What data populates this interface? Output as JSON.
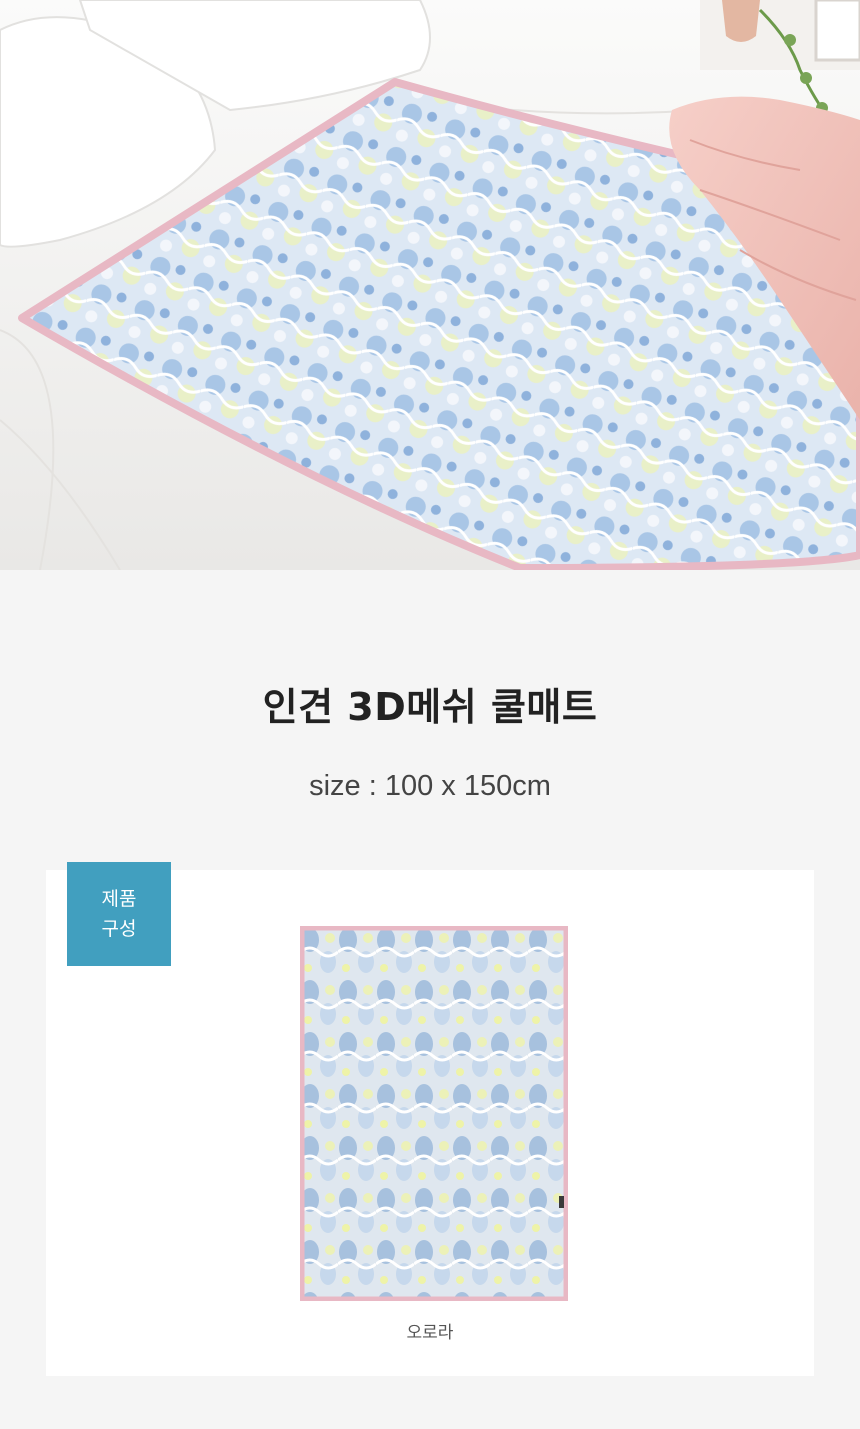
{
  "header": {
    "title": "인견 3D메쉬 쿨매트",
    "size_text": "size : 100 x 150cm"
  },
  "hero": {
    "image": "bed-with-quilted-mat-photo"
  },
  "composition": {
    "badge_line1": "제품",
    "badge_line2": "구성",
    "product_image": "quilted-mat-flat-photo",
    "product_name": "오로라"
  },
  "colors": {
    "page_bg": "#f5f5f5",
    "card_bg": "#ffffff",
    "badge_bg": "#419fbf",
    "mat_border": "#e8b8c4",
    "mat_pattern": "#a9c6e6"
  }
}
